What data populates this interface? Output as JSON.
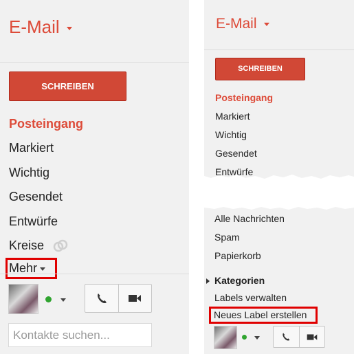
{
  "app_title": "E-Mail",
  "compose_label": "SCHREIBEN",
  "left_nav": [
    "Posteingang",
    "Markiert",
    "Wichtig",
    "Gesendet",
    "Entwürfe",
    "Kreise"
  ],
  "more_label": "Mehr",
  "contacts_placeholder": "Kontakte suchen...",
  "right_top_nav": [
    "Posteingang",
    "Markiert",
    "Wichtig",
    "Gesendet",
    "Entwürfe"
  ],
  "right_bottom_nav": [
    "Alle Nachrichten",
    "Spam",
    "Papierkorb"
  ],
  "categories_label": "Kategorien",
  "manage_labels": "Labels verwalten",
  "new_label": "Neues Label erstellen",
  "colors": {
    "brand_red": "#dd4b39",
    "compose_bg": "#d14836",
    "highlight_box": "#e00000",
    "status_green": "#2fa42f"
  },
  "icons": [
    "circles-link-icon",
    "phone-icon",
    "video-camera-icon",
    "triangle-right-icon"
  ]
}
